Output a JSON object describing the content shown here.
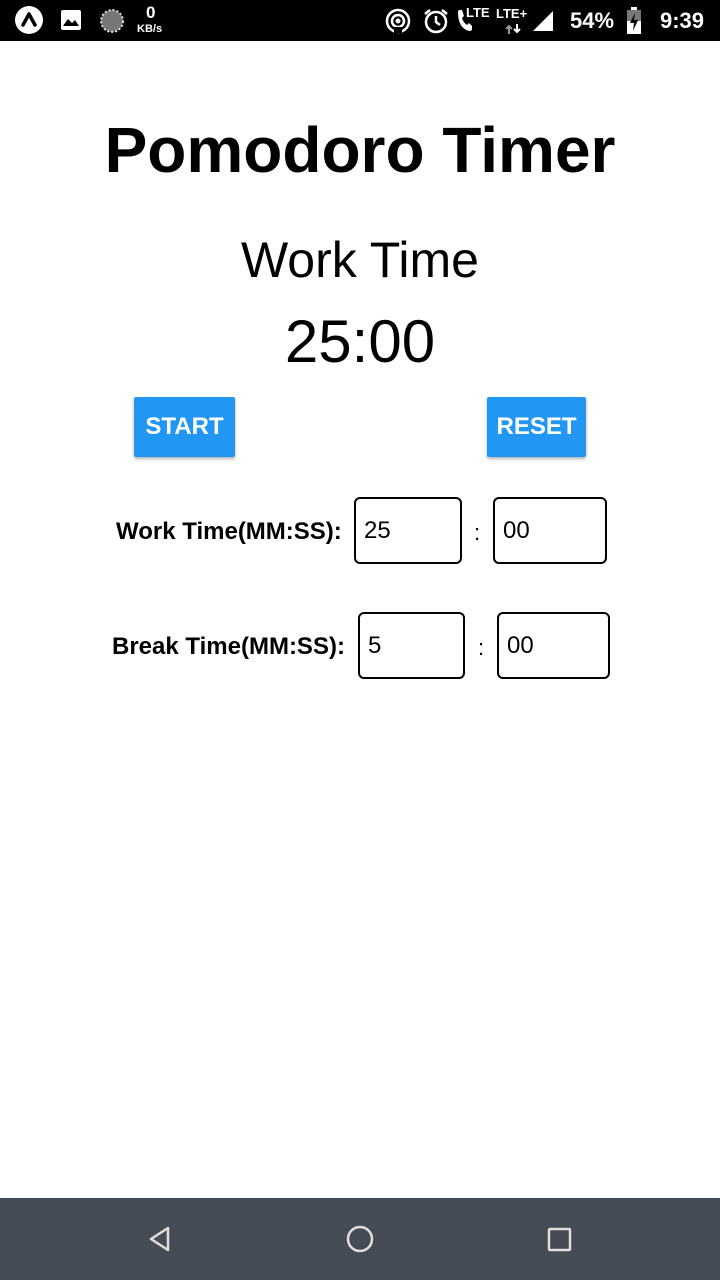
{
  "status_bar": {
    "speed_value": "0",
    "speed_unit": "KB/s",
    "lte1": "LTE",
    "lte2": "LTE+",
    "battery": "54%",
    "time": "9:39"
  },
  "app": {
    "title": "Pomodoro Timer",
    "mode": "Work Time",
    "timer": "25:00",
    "start_label": "START",
    "reset_label": "RESET"
  },
  "settings": {
    "work_label": "Work Time(MM:SS):",
    "work_minutes": "25",
    "work_seconds": "00",
    "break_label": "Break Time(MM:SS):",
    "break_minutes": "5",
    "break_seconds": "00",
    "separator": ":"
  },
  "nav_bar": {
    "icons": [
      "back-icon",
      "home-icon",
      "recents-icon"
    ]
  },
  "colors": {
    "accent": "#2196f3",
    "nav_bg": "#464c55",
    "status_bg": "#000000"
  }
}
